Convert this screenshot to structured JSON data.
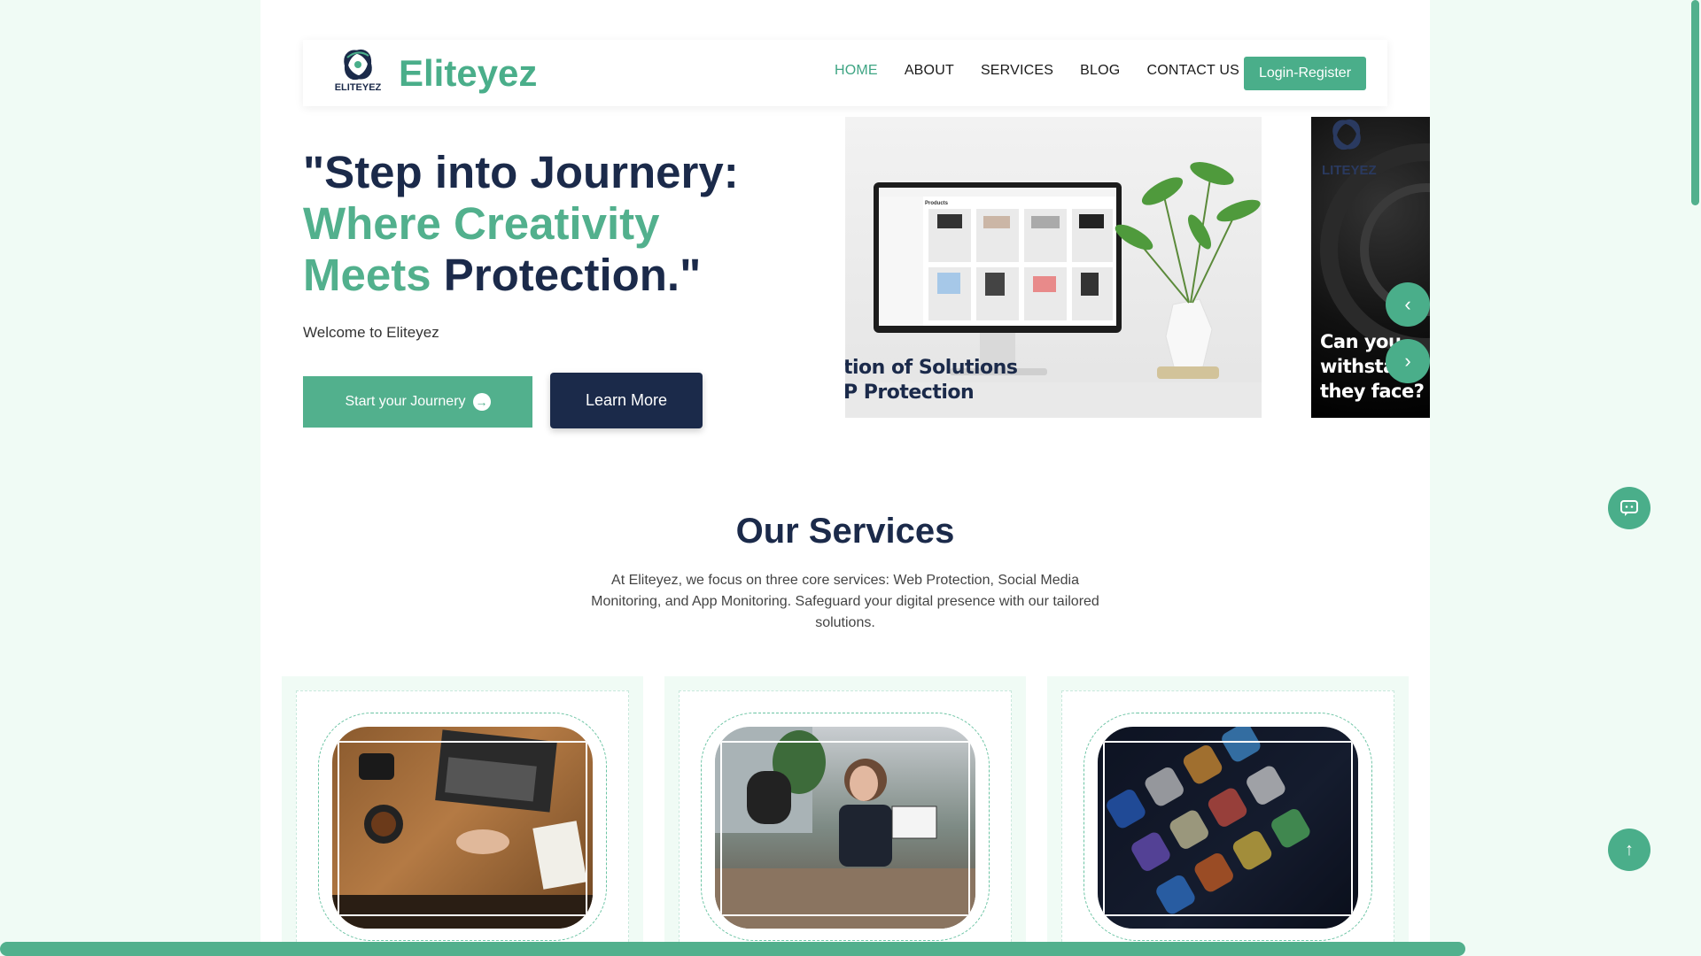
{
  "brand": {
    "name": "Eliteyez",
    "logo_text": "ELITEYEZ"
  },
  "nav": {
    "items": [
      {
        "label": "HOME",
        "active": true
      },
      {
        "label": "ABOUT",
        "active": false
      },
      {
        "label": "SERVICES",
        "active": false
      },
      {
        "label": "BLOG",
        "active": false
      },
      {
        "label": "CONTACT US",
        "active": false
      }
    ],
    "login_label": "Login-Register"
  },
  "hero": {
    "title_part1": "\"Step into Journery:",
    "title_green1": " Where Creativity",
    "title_green2": "Meets",
    "title_part2": " Protection.\"",
    "welcome": "Welcome to Eliteyez",
    "start_label": "Start your Journery",
    "learn_label": "Learn More"
  },
  "slider": {
    "slide1_line1": "tion of Solutions",
    "slide1_line2": "P Protection",
    "slide1_screen_heading": "Products",
    "slide2_brand": "LITEYEZ",
    "slide2_line1": "Can you",
    "slide2_line2": "withsta",
    "slide2_line3": "they face?"
  },
  "services": {
    "title": "Our Services",
    "description": "At Eliteyez, we focus on three core services: Web Protection, Social Media Monitoring, and App Monitoring. Safeguard your digital presence with our tailored solutions."
  },
  "colors": {
    "accent": "#4aae8a",
    "navy": "#1b2a4a",
    "background": "#f0fbf5"
  }
}
